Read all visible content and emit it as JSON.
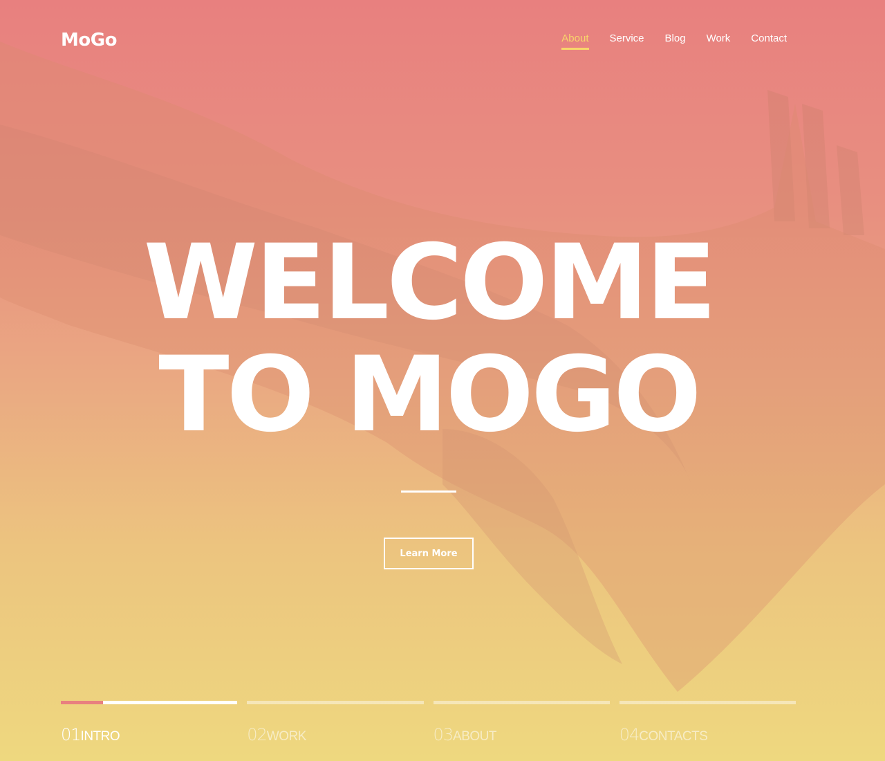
{
  "brand": {
    "logo": "MoGo"
  },
  "nav": {
    "items": [
      {
        "label": "About",
        "active": true
      },
      {
        "label": "Service",
        "active": false
      },
      {
        "label": "Blog",
        "active": false
      },
      {
        "label": "Work",
        "active": false
      },
      {
        "label": "Contact",
        "active": false
      }
    ]
  },
  "hero": {
    "line1": "WELCOME",
    "line2": "TO MOGO",
    "cta": "Learn More"
  },
  "slider": {
    "items": [
      {
        "number": "01",
        "label": "Intro",
        "active": true,
        "progress": 0.24
      },
      {
        "number": "02",
        "label": "Work",
        "active": false,
        "progress": 0
      },
      {
        "number": "03",
        "label": "About",
        "active": false,
        "progress": 0
      },
      {
        "number": "04",
        "label": "Contacts",
        "active": false,
        "progress": 0
      }
    ]
  },
  "colors": {
    "accent": "#f8d66a",
    "progress": "#e8807f",
    "gradient_top": "#e8807f",
    "gradient_bottom": "#eed87f"
  }
}
